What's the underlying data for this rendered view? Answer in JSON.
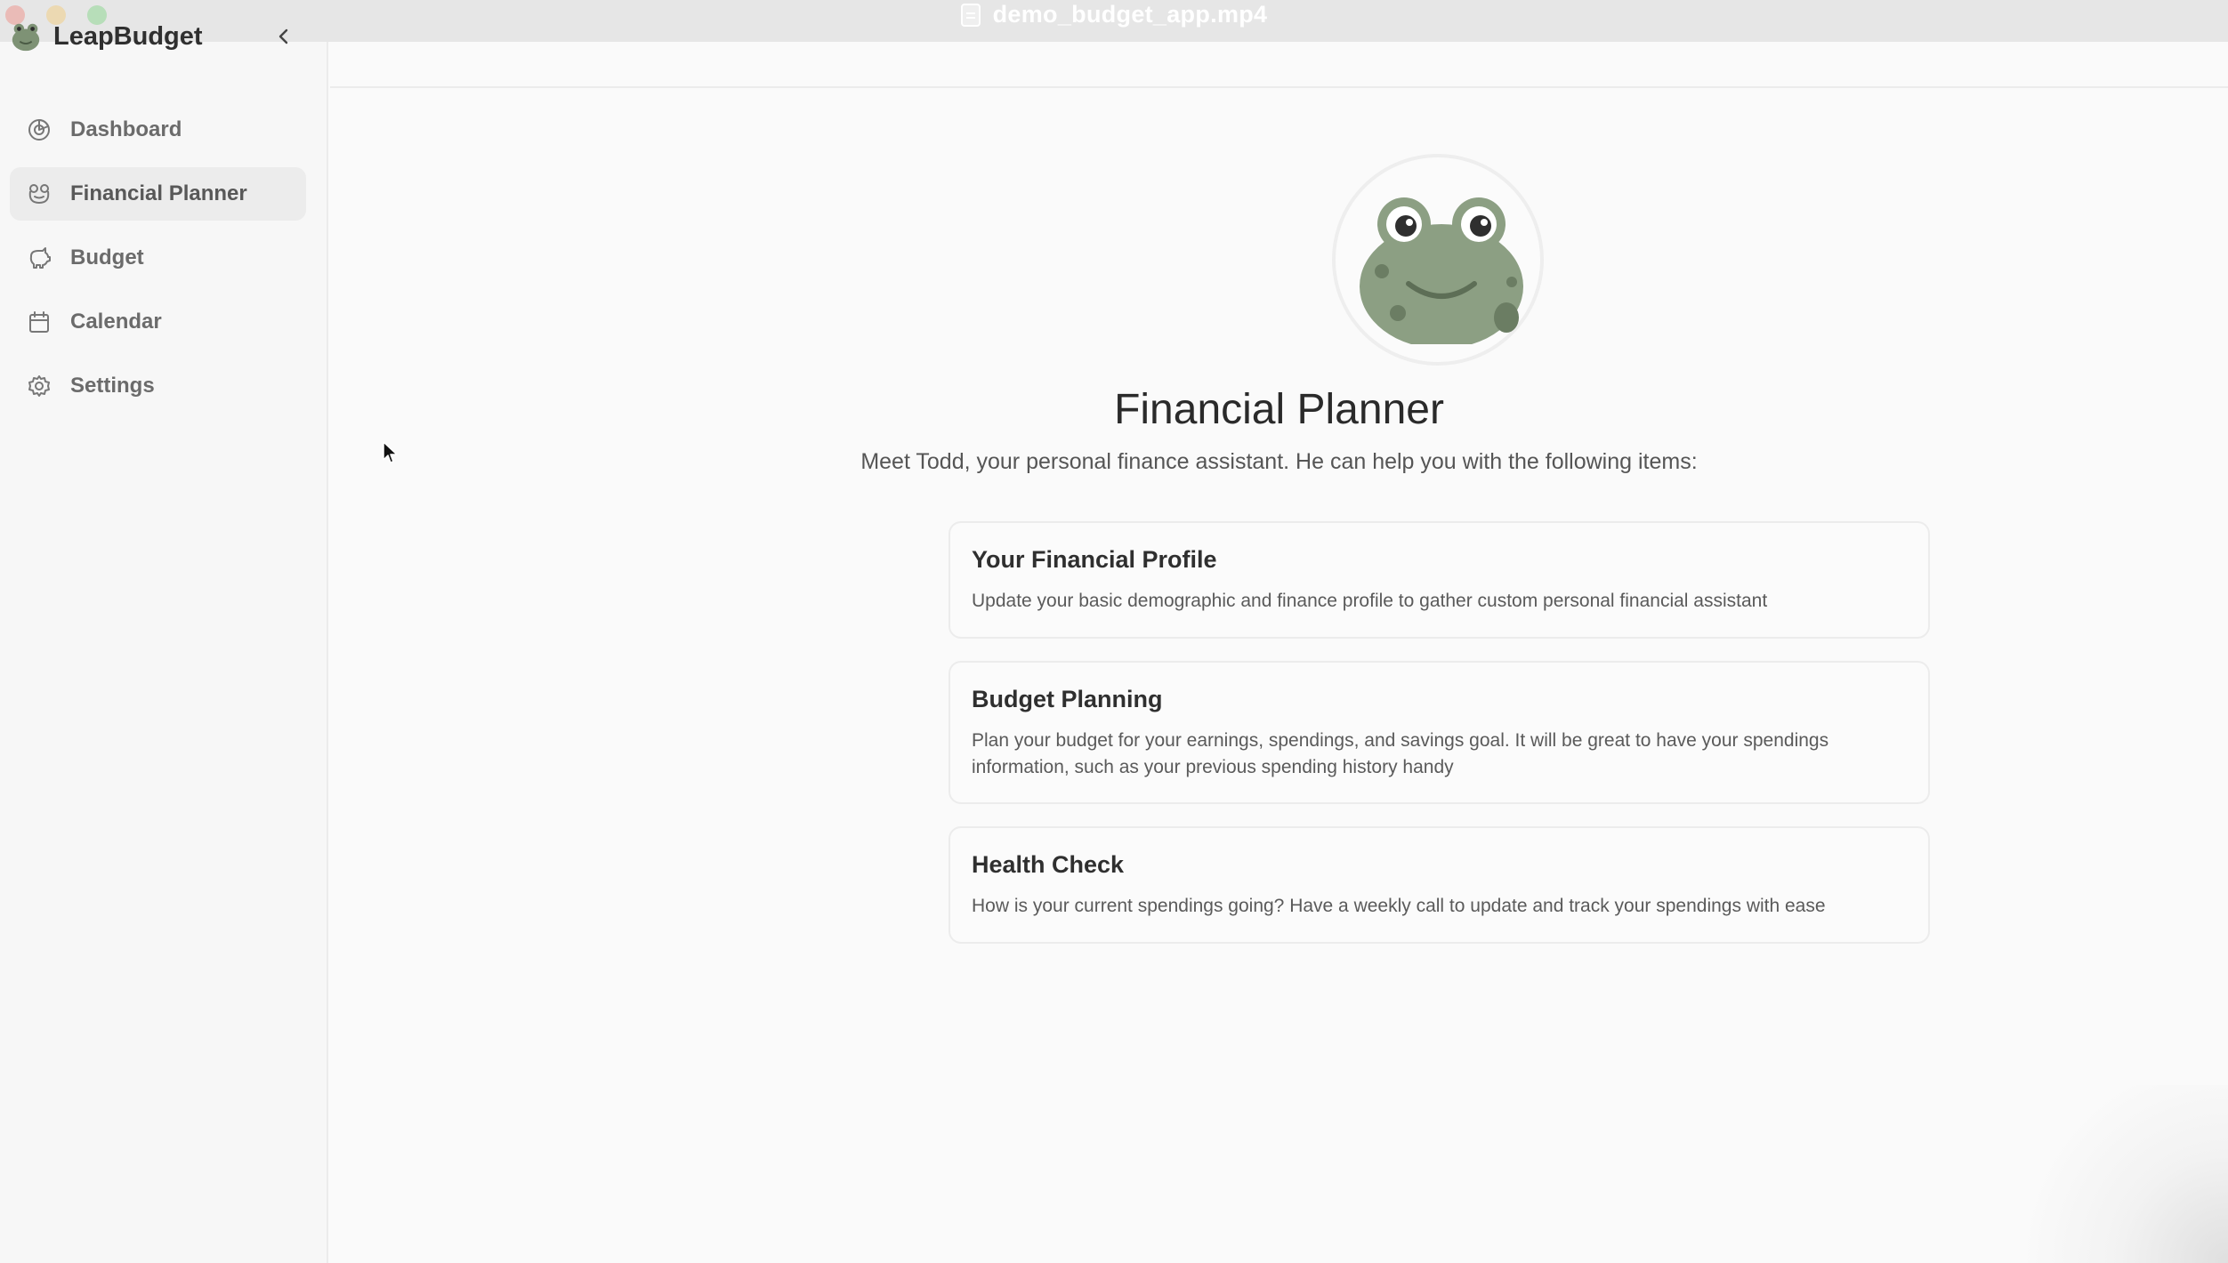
{
  "window": {
    "title": "demo_budget_app.mp4"
  },
  "app": {
    "name": "LeapBudget"
  },
  "sidebar": {
    "items": [
      {
        "label": "Dashboard",
        "icon": "dashboard-icon",
        "active": false
      },
      {
        "label": "Financial Planner",
        "icon": "frog-icon",
        "active": true
      },
      {
        "label": "Budget",
        "icon": "piggy-bank-icon",
        "active": false
      },
      {
        "label": "Calendar",
        "icon": "calendar-icon",
        "active": false
      },
      {
        "label": "Settings",
        "icon": "gear-icon",
        "active": false
      }
    ]
  },
  "main": {
    "title": "Financial Planner",
    "subtitle": "Meet Todd, your personal finance assistant. He can help you with the following items:",
    "cards": [
      {
        "title": "Your Financial Profile",
        "description": "Update your basic demographic and finance profile to gather custom personal financial assistant"
      },
      {
        "title": "Budget Planning",
        "description": "Plan your budget for your earnings, spendings, and savings goal. It will be great to have your spendings information, such as your previous spending history handy"
      },
      {
        "title": "Health Check",
        "description": "How is your current spendings going? Have a weekly call to update and track your spendings with ease"
      }
    ]
  },
  "colors": {
    "frog_green": "#8c9f83",
    "frog_spot": "#6b7d63",
    "active_nav_bg": "#ececec",
    "text_primary": "#2f2f2f",
    "text_muted": "#6b6b6b"
  }
}
